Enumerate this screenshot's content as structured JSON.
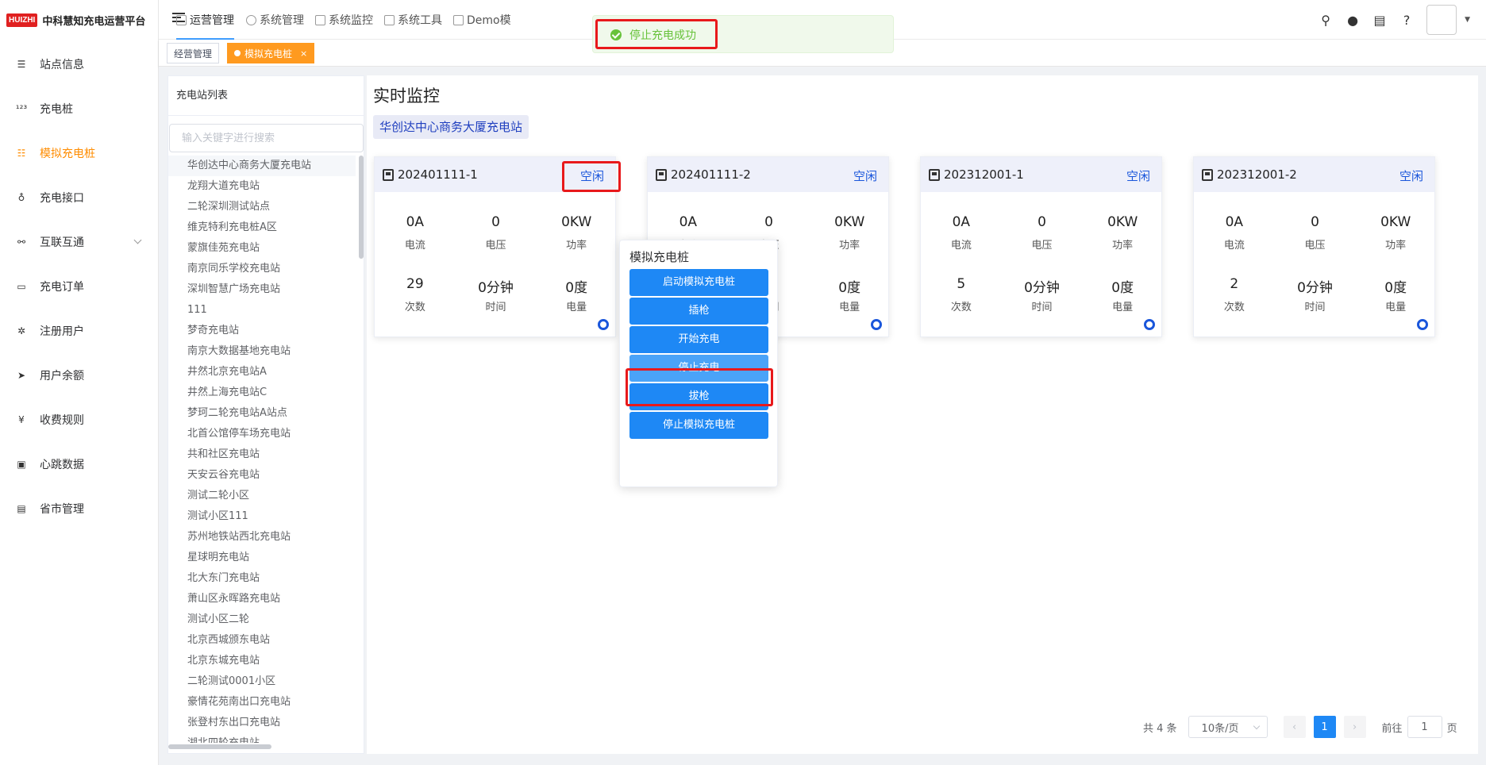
{
  "app": {
    "logo_badge": "HUIZHI",
    "name": "中科慧知充电运营平台"
  },
  "sidebar": {
    "items": [
      {
        "label": "站点信息",
        "icon": "list-icon",
        "glyph": "☰"
      },
      {
        "label": "充电桩",
        "icon": "numbers-icon",
        "glyph": "¹²³"
      },
      {
        "label": "模拟充电桩",
        "icon": "tree-list-icon",
        "glyph": "☷",
        "active": true
      },
      {
        "label": "充电接口",
        "icon": "plug-icon",
        "glyph": "♁"
      },
      {
        "label": "互联互通",
        "icon": "connect-icon",
        "glyph": "⚯",
        "expandable": true
      },
      {
        "label": "充电订单",
        "icon": "monitor-icon",
        "glyph": "▭"
      },
      {
        "label": "注册用户",
        "icon": "bug-icon",
        "glyph": "✲"
      },
      {
        "label": "用户余额",
        "icon": "send-icon",
        "glyph": "➤"
      },
      {
        "label": "收费规则",
        "icon": "yen-icon",
        "glyph": "¥"
      },
      {
        "label": "心跳数据",
        "icon": "chart-box-icon",
        "glyph": "▣"
      },
      {
        "label": "省市管理",
        "icon": "document-icon",
        "glyph": "▤"
      }
    ]
  },
  "topnav": {
    "items": [
      {
        "label": "运营管理",
        "active": true
      },
      {
        "label": "系统管理"
      },
      {
        "label": "系统监控"
      },
      {
        "label": "系统工具"
      },
      {
        "label": "Demo模"
      }
    ]
  },
  "tags": {
    "home": "经营管理",
    "current": "模拟充电桩",
    "close": "×"
  },
  "toast": {
    "message": "停止充电成功"
  },
  "stations": {
    "title": "充电站列表",
    "search_placeholder": "输入关键字进行搜索",
    "items": [
      "华创达中心商务大厦充电站",
      "龙翔大道充电站",
      "二轮深圳测试站点",
      "维克特利充电桩A区",
      "蒙旗佳苑充电站",
      "南京同乐学校充电站",
      "深圳智慧广场充电站",
      "111",
      "梦奇充电站",
      "南京大数据基地充电站",
      "井然北京充电站A",
      "井然上海充电站C",
      "梦珂二轮充电站A站点",
      "北首公馆停车场充电站",
      "共和社区充电站",
      "天安云谷充电站",
      "测试二轮小区",
      "测试小区111",
      "苏州地铁站西北充电站",
      "星球明充电站",
      "北大东门充电站",
      "萧山区永晖路充电站",
      "测试小区二轮",
      "北京西城颁东电站",
      "北京东城充电站",
      "二轮测试0001小区",
      "豪情花苑南出口充电站",
      "张登村东出口充电站",
      "湖北四轮充电站"
    ]
  },
  "monitor": {
    "title": "实时监控",
    "station": "华创达中心商务大厦充电站",
    "labels": {
      "current": "电流",
      "voltage": "电压",
      "power": "功率",
      "count": "次数",
      "time": "时间",
      "energy": "电量"
    },
    "piles": [
      {
        "code": "202401111-1",
        "status": "空闲",
        "current": "0A",
        "voltage": "0",
        "power": "0KW",
        "count": "29",
        "time": "0分钟",
        "energy": "0度"
      },
      {
        "code": "202401111-2",
        "status": "空闲",
        "current": "0A",
        "voltage": "0",
        "power": "0KW",
        "count": "",
        "time": "",
        "energy": "0度"
      },
      {
        "code": "202312001-1",
        "status": "空闲",
        "current": "0A",
        "voltage": "0",
        "power": "0KW",
        "count": "5",
        "time": "0分钟",
        "energy": "0度"
      },
      {
        "code": "202312001-2",
        "status": "空闲",
        "current": "0A",
        "voltage": "0",
        "power": "0KW",
        "count": "2",
        "time": "0分钟",
        "energy": "0度"
      }
    ]
  },
  "sim_menu": {
    "title": "模拟充电桩",
    "buttons": [
      "启动模拟充电桩",
      "插枪",
      "开始充电",
      "停止充电",
      "拔枪",
      "停止模拟充电桩"
    ]
  },
  "pagination": {
    "total": "共 4 条",
    "page_size": "10条/页",
    "current_page": "1",
    "goto_prefix": "前往",
    "goto_value": "1",
    "goto_suffix": "页"
  },
  "colors": {
    "accent": "#1e88f5",
    "active_menu": "#ff8c00",
    "status": "#1a56db",
    "highlight": "#e8191b",
    "success": "#67c23a"
  }
}
